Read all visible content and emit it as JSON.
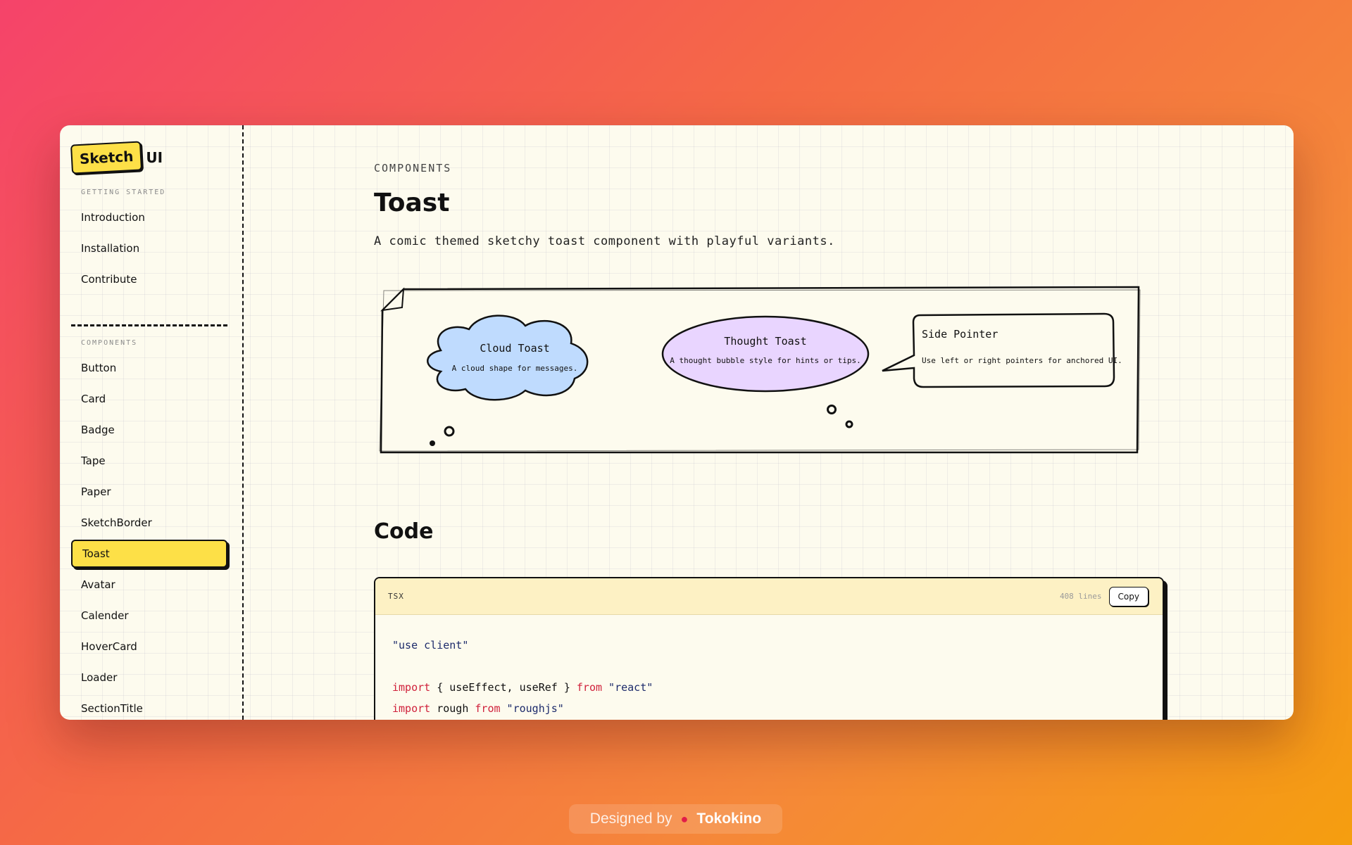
{
  "logo": {
    "badge": "Sketch",
    "suffix": "UI"
  },
  "sidebar": {
    "getting_started_label": "GETTING STARTED",
    "getting_started": [
      "Introduction",
      "Installation",
      "Contribute"
    ],
    "components_label": "COMPONENTS",
    "components": [
      "Button",
      "Card",
      "Badge",
      "Tape",
      "Paper",
      "SketchBorder",
      "Toast",
      "Avatar",
      "Calender",
      "HoverCard",
      "Loader",
      "SectionTitle"
    ],
    "active": "Toast"
  },
  "page": {
    "breadcrumb": "COMPONENTS",
    "title": "Toast",
    "description": "A comic themed sketchy toast component with playful variants.",
    "code_title": "Code"
  },
  "toasts": {
    "cloud": {
      "title": "Cloud Toast",
      "text": "A cloud shape for messages.",
      "color": "#bfdbfe"
    },
    "thought": {
      "title": "Thought Toast",
      "text": "A thought bubble style for hints or tips.",
      "color": "#e9d5ff"
    },
    "side": {
      "title": "Side Pointer",
      "text": "Use left or right pointers for anchored UI.",
      "color": "#fdfbee"
    }
  },
  "code": {
    "lang": "TSX",
    "lines_count": "408 lines",
    "copy_label": "Copy",
    "line1": "\"use client\"",
    "l2_kw1": "import",
    "l2_mid": " { useEffect, useRef } ",
    "l2_kw2": "from",
    "l2_str": " \"react\"",
    "l3_kw1": "import",
    "l3_mid": " rough ",
    "l3_kw2": "from",
    "l3_str": " \"roughjs\""
  },
  "footer": {
    "prefix": "Designed by",
    "brand": "Tokokino"
  },
  "colors": {
    "accent": "#fde047",
    "keyword": "#d0223c",
    "string": "#1d2b6b"
  }
}
